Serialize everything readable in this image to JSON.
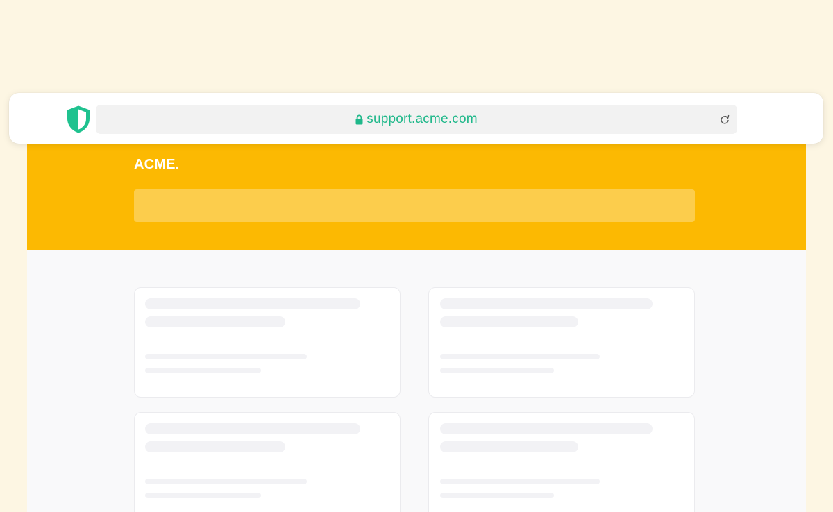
{
  "browser": {
    "url": "support.acme.com",
    "icons": {
      "security": "shield-icon",
      "secure": "lock-icon",
      "reload": "reload-icon"
    },
    "accent_color": "#1FB88A"
  },
  "site": {
    "logo": "ACME.",
    "header_color": "#FCB902",
    "search_color": "#FCCD4C"
  },
  "cards": [
    {
      "state": "loading"
    },
    {
      "state": "loading"
    },
    {
      "state": "loading"
    },
    {
      "state": "loading"
    }
  ]
}
